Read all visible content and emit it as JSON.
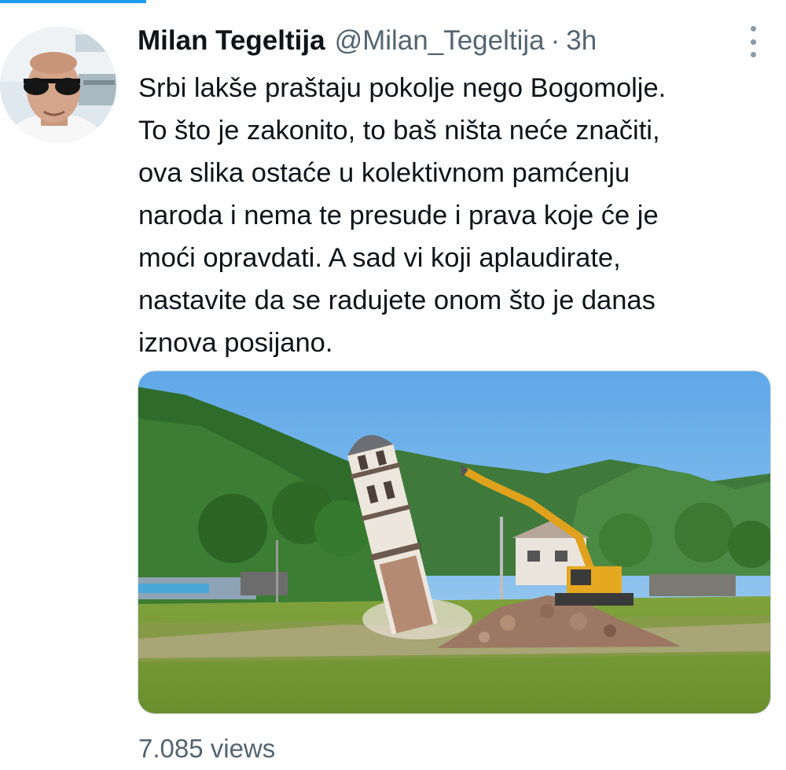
{
  "tweet": {
    "display_name": "Milan Tegeltija",
    "handle": "@Milan_Tegeltija",
    "separator": "·",
    "timestamp": "3h",
    "text_lines": [
      "Srbi lakše praštaju pokolje nego Bogomolje.",
      "To što je zakonito, to baš ništa neće značiti,",
      "ova slika ostaće u kolektivnom pamćenju",
      "naroda i nema te presude i prava koje će je",
      "moći opravdati. A sad vi koji aplaudirate,",
      "nastavite da se radujete onom što je danas",
      "iznova posijano."
    ],
    "views": "7.085 views"
  },
  "icons": {
    "more": "more-options-icon"
  },
  "colors": {
    "accent": "#1d9bf0",
    "text_primary": "#0f1419",
    "text_secondary": "#536471"
  }
}
